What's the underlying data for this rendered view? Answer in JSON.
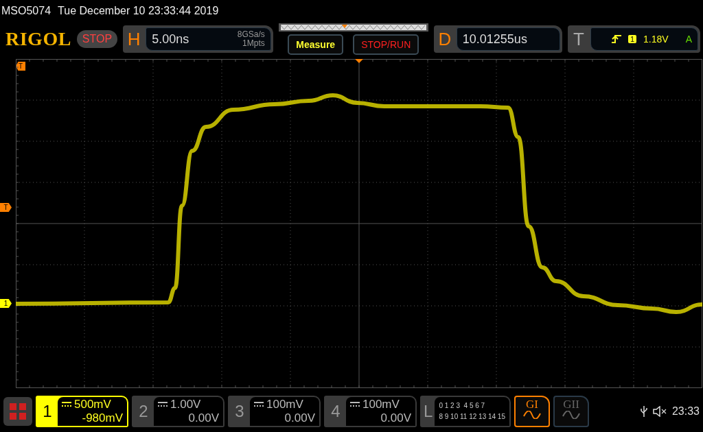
{
  "header": {
    "model": "MSO5074",
    "datetime": "Tue December 10 23:33:44 2019"
  },
  "toolbar": {
    "logo": "RIGOL",
    "run_state": "STOP",
    "horizontal": {
      "letter": "H",
      "timebase": "5.00ns",
      "sample_rate": "8GSa/s",
      "memory": "1Mpts"
    },
    "measure_button": "Measure",
    "stop_run_button": "STOP/RUN",
    "delay": {
      "letter": "D",
      "value": "10.01255us"
    },
    "trigger": {
      "letter": "T",
      "source": "1",
      "level": "1.18V",
      "mode": "A"
    }
  },
  "markers": [
    {
      "label": "T",
      "kind": "top"
    },
    {
      "label": "T",
      "kind": "level"
    },
    {
      "label": "1",
      "kind": "channel"
    }
  ],
  "channels": [
    {
      "number": "1",
      "scale": "500mV",
      "offset": "-980mV",
      "selected": true
    },
    {
      "number": "2",
      "scale": "1.00V",
      "offset": "0.00V",
      "selected": false
    },
    {
      "number": "3",
      "scale": "100mV",
      "offset": "0.00V",
      "selected": false
    },
    {
      "number": "4",
      "scale": "100mV",
      "offset": "0.00V",
      "selected": false
    }
  ],
  "logic": {
    "letter": "L",
    "rows": [
      "0 1 2 3  4 5 6 7",
      "8 9 10 11 12 13 14 15"
    ]
  },
  "generators": [
    {
      "label": "GI",
      "selected": true
    },
    {
      "label": "GII",
      "selected": false
    }
  ],
  "status": {
    "time": "23:33"
  }
}
